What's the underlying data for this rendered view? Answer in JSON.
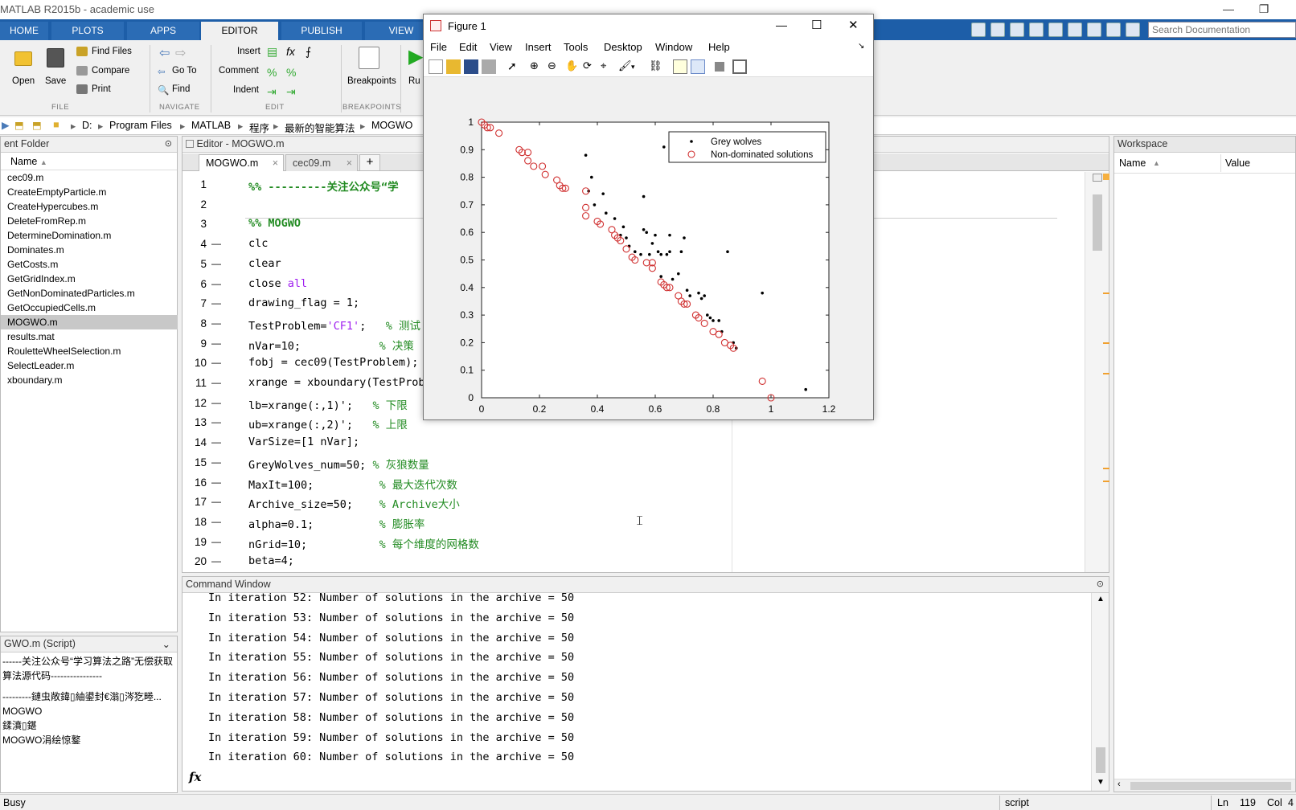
{
  "window": {
    "title": "MATLAB R2015b - academic use",
    "minimize": "—",
    "restore": "❐"
  },
  "tabs": [
    "HOME",
    "PLOTS",
    "APPS",
    "EDITOR",
    "PUBLISH",
    "VIEW"
  ],
  "search": {
    "placeholder": "Search Documentation"
  },
  "ribbon": {
    "open": "Open",
    "save": "Save",
    "find_files": "Find Files",
    "compare": "Compare",
    "print": "Print",
    "go_to": "Go To",
    "find": "Find",
    "insert": "Insert",
    "comment": "Comment",
    "indent": "Indent",
    "breakpoints": "Breakpoints",
    "run": "Ru",
    "sections": {
      "file": "FILE",
      "navigate": "NAVIGATE",
      "edit": "EDIT",
      "breakpoints": "BREAKPOINTS"
    }
  },
  "path": [
    "D:",
    "Program Files",
    "MATLAB",
    "程序",
    "最新的智能算法",
    "MOGWO"
  ],
  "current_folder": {
    "title": "ent Folder",
    "column_name": "Name",
    "files": [
      "cec09.m",
      "CreateEmptyParticle.m",
      "CreateHypercubes.m",
      "DeleteFromRep.m",
      "DetermineDomination.m",
      "Dominates.m",
      "GetCosts.m",
      "GetGridIndex.m",
      "GetNonDominatedParticles.m",
      "GetOccupiedCells.m",
      "MOGWO.m",
      "results.mat",
      "RouletteWheelSelection.m",
      "SelectLeader.m",
      "xboundary.m"
    ],
    "selected": "MOGWO.m"
  },
  "details": {
    "title": "GWO.m  (Script)",
    "lines": [
      "------关注公众号“学习算法之路”无偿获取",
      "算法源代码----------------",
      "---------鏈虫敞鍏▯紬鍙封€滃▯涔犵畻...",
      "MOGWO",
      "鍒濆▯鍖",
      "MOGWO涓绘惊鐜"
    ]
  },
  "editor": {
    "title": "Editor - MOGWO.m",
    "tabs": [
      "MOGWO.m",
      "cec09.m"
    ],
    "add_tab": "+",
    "lines": [
      {
        "n": "1",
        "d": "",
        "parts": [
          {
            "t": "%% ---------关注公众号“学",
            "c": "#228b22",
            "b": true
          }
        ]
      },
      {
        "n": "2",
        "d": "",
        "parts": []
      },
      {
        "n": "3",
        "d": "",
        "parts": [
          {
            "t": "%% MOGWO",
            "c": "#228b22",
            "b": true
          }
        ]
      },
      {
        "n": "4",
        "d": "—",
        "parts": [
          {
            "t": "clc",
            "c": "#000"
          }
        ]
      },
      {
        "n": "5",
        "d": "—",
        "parts": [
          {
            "t": "clear",
            "c": "#000"
          }
        ]
      },
      {
        "n": "6",
        "d": "—",
        "parts": [
          {
            "t": "close ",
            "c": "#000"
          },
          {
            "t": "all",
            "c": "#a020f0"
          }
        ]
      },
      {
        "n": "7",
        "d": "—",
        "parts": [
          {
            "t": "drawing_flag = 1;",
            "c": "#000"
          }
        ]
      },
      {
        "n": "8",
        "d": "—",
        "parts": [
          {
            "t": "TestProblem=",
            "c": "#000"
          },
          {
            "t": "'CF1'",
            "c": "#a020f0"
          },
          {
            "t": ";   ",
            "c": "#000"
          },
          {
            "t": "% 测试",
            "c": "#228b22"
          }
        ]
      },
      {
        "n": "9",
        "d": "—",
        "parts": [
          {
            "t": "nVar=10;            ",
            "c": "#000"
          },
          {
            "t": "% 决策",
            "c": "#228b22"
          }
        ]
      },
      {
        "n": "10",
        "d": "—",
        "parts": [
          {
            "t": "fobj = cec09(TestProblem);",
            "c": "#000"
          }
        ]
      },
      {
        "n": "11",
        "d": "—",
        "parts": [
          {
            "t": "xrange = xboundary(TestProb",
            "c": "#000"
          }
        ]
      },
      {
        "n": "12",
        "d": "—",
        "parts": [
          {
            "t": "lb=xrange(:,1)';   ",
            "c": "#000"
          },
          {
            "t": "% 下限",
            "c": "#228b22"
          }
        ]
      },
      {
        "n": "13",
        "d": "—",
        "parts": [
          {
            "t": "ub=xrange(:,2)';   ",
            "c": "#000"
          },
          {
            "t": "% 上限",
            "c": "#228b22"
          }
        ]
      },
      {
        "n": "14",
        "d": "—",
        "parts": [
          {
            "t": "VarSize=[1 nVar];",
            "c": "#000"
          }
        ]
      },
      {
        "n": "15",
        "d": "—",
        "parts": [
          {
            "t": "GreyWolves_num=50; ",
            "c": "#000"
          },
          {
            "t": "% 灰狼数量",
            "c": "#228b22"
          }
        ]
      },
      {
        "n": "16",
        "d": "—",
        "parts": [
          {
            "t": "MaxIt=100;          ",
            "c": "#000"
          },
          {
            "t": "% 最大迭代次数",
            "c": "#228b22"
          }
        ]
      },
      {
        "n": "17",
        "d": "—",
        "parts": [
          {
            "t": "Archive_size=50;    ",
            "c": "#000"
          },
          {
            "t": "% Archive大小",
            "c": "#228b22"
          }
        ]
      },
      {
        "n": "18",
        "d": "—",
        "parts": [
          {
            "t": "alpha=0.1;          ",
            "c": "#000"
          },
          {
            "t": "% 膨胀率",
            "c": "#228b22"
          }
        ]
      },
      {
        "n": "19",
        "d": "—",
        "parts": [
          {
            "t": "nGrid=10;           ",
            "c": "#000"
          },
          {
            "t": "% 每个维度的网格数",
            "c": "#228b22"
          }
        ]
      },
      {
        "n": "20",
        "d": "—",
        "parts": [
          {
            "t": "beta=4;",
            "c": "#000"
          }
        ]
      }
    ]
  },
  "command_window": {
    "title": "Command Window",
    "lines": [
      "In iteration 52: Number of solutions in the archive = 50",
      "In iteration 53: Number of solutions in the archive = 50",
      "In iteration 54: Number of solutions in the archive = 50",
      "In iteration 55: Number of solutions in the archive = 50",
      "In iteration 56: Number of solutions in the archive = 50",
      "In iteration 57: Number of solutions in the archive = 50",
      "In iteration 58: Number of solutions in the archive = 50",
      "In iteration 59: Number of solutions in the archive = 50",
      "In iteration 60: Number of solutions in the archive = 50"
    ],
    "prompt": "fx"
  },
  "workspace": {
    "title": "Workspace",
    "col_name": "Name",
    "col_value": "Value"
  },
  "status": {
    "left": "Busy",
    "mode": "script",
    "ln_label": "Ln",
    "ln": "119",
    "col_label": "Col",
    "col": "4"
  },
  "figure": {
    "title": "Figure 1",
    "menu": [
      "File",
      "Edit",
      "View",
      "Insert",
      "Tools",
      "Desktop",
      "Window",
      "Help"
    ],
    "close": "✕",
    "maximize": "☐",
    "minimize": "—"
  },
  "colors": {
    "accent": "#1d5ea8",
    "comment": "#228b22",
    "string": "#a020f0",
    "pareto": "#d03030"
  },
  "chart_data": {
    "type": "scatter",
    "xlim": [
      0,
      1.2
    ],
    "ylim": [
      0,
      1
    ],
    "xticks": [
      "0",
      "0.2",
      "0.4",
      "0.6",
      "0.8",
      "1",
      "1.2"
    ],
    "yticks": [
      "0",
      "0.1",
      "0.2",
      "0.3",
      "0.4",
      "0.5",
      "0.6",
      "0.7",
      "0.8",
      "0.9",
      "1"
    ],
    "legend_position": "top-right",
    "series": [
      {
        "name": "Grey wolves",
        "marker": "dot",
        "points": [
          [
            0.36,
            0.88
          ],
          [
            0.37,
            0.75
          ],
          [
            0.38,
            0.8
          ],
          [
            0.39,
            0.7
          ],
          [
            0.42,
            0.74
          ],
          [
            0.43,
            0.67
          ],
          [
            0.46,
            0.65
          ],
          [
            0.48,
            0.59
          ],
          [
            0.49,
            0.62
          ],
          [
            0.5,
            0.58
          ],
          [
            0.51,
            0.55
          ],
          [
            0.53,
            0.53
          ],
          [
            0.55,
            0.52
          ],
          [
            0.56,
            0.73
          ],
          [
            0.56,
            0.61
          ],
          [
            0.57,
            0.6
          ],
          [
            0.58,
            0.52
          ],
          [
            0.59,
            0.56
          ],
          [
            0.6,
            0.59
          ],
          [
            0.61,
            0.53
          ],
          [
            0.62,
            0.52
          ],
          [
            0.63,
            0.91
          ],
          [
            0.64,
            0.52
          ],
          [
            0.65,
            0.59
          ],
          [
            0.65,
            0.53
          ],
          [
            0.62,
            0.44
          ],
          [
            0.66,
            0.43
          ],
          [
            0.68,
            0.45
          ],
          [
            0.69,
            0.53
          ],
          [
            0.7,
            0.58
          ],
          [
            0.71,
            0.39
          ],
          [
            0.72,
            0.37
          ],
          [
            0.75,
            0.38
          ],
          [
            0.76,
            0.36
          ],
          [
            0.77,
            0.37
          ],
          [
            0.78,
            0.3
          ],
          [
            0.79,
            0.29
          ],
          [
            0.8,
            0.28
          ],
          [
            0.82,
            0.28
          ],
          [
            0.83,
            0.24
          ],
          [
            0.85,
            0.53
          ],
          [
            0.97,
            0.38
          ],
          [
            1.12,
            0.03
          ],
          [
            0.88,
            0.18
          ],
          [
            0.87,
            0.2
          ]
        ]
      },
      {
        "name": "Non-dominated solutions",
        "marker": "circle",
        "points": [
          [
            0.0,
            1.0
          ],
          [
            0.01,
            0.99
          ],
          [
            0.02,
            0.98
          ],
          [
            0.03,
            0.98
          ],
          [
            0.06,
            0.96
          ],
          [
            0.13,
            0.9
          ],
          [
            0.14,
            0.89
          ],
          [
            0.16,
            0.89
          ],
          [
            0.16,
            0.86
          ],
          [
            0.18,
            0.84
          ],
          [
            0.21,
            0.84
          ],
          [
            0.22,
            0.81
          ],
          [
            0.26,
            0.79
          ],
          [
            0.27,
            0.77
          ],
          [
            0.28,
            0.76
          ],
          [
            0.29,
            0.76
          ],
          [
            0.36,
            0.75
          ],
          [
            0.36,
            0.69
          ],
          [
            0.36,
            0.66
          ],
          [
            0.4,
            0.64
          ],
          [
            0.41,
            0.63
          ],
          [
            0.45,
            0.61
          ],
          [
            0.46,
            0.59
          ],
          [
            0.47,
            0.58
          ],
          [
            0.48,
            0.57
          ],
          [
            0.5,
            0.54
          ],
          [
            0.52,
            0.51
          ],
          [
            0.53,
            0.5
          ],
          [
            0.57,
            0.49
          ],
          [
            0.59,
            0.49
          ],
          [
            0.59,
            0.47
          ],
          [
            0.62,
            0.42
          ],
          [
            0.63,
            0.41
          ],
          [
            0.64,
            0.4
          ],
          [
            0.65,
            0.4
          ],
          [
            0.68,
            0.37
          ],
          [
            0.69,
            0.35
          ],
          [
            0.7,
            0.34
          ],
          [
            0.71,
            0.34
          ],
          [
            0.74,
            0.3
          ],
          [
            0.75,
            0.29
          ],
          [
            0.77,
            0.27
          ],
          [
            0.8,
            0.24
          ],
          [
            0.82,
            0.23
          ],
          [
            0.84,
            0.2
          ],
          [
            0.86,
            0.19
          ],
          [
            0.87,
            0.18
          ],
          [
            0.97,
            0.06
          ],
          [
            1.0,
            0.0
          ]
        ]
      }
    ]
  }
}
